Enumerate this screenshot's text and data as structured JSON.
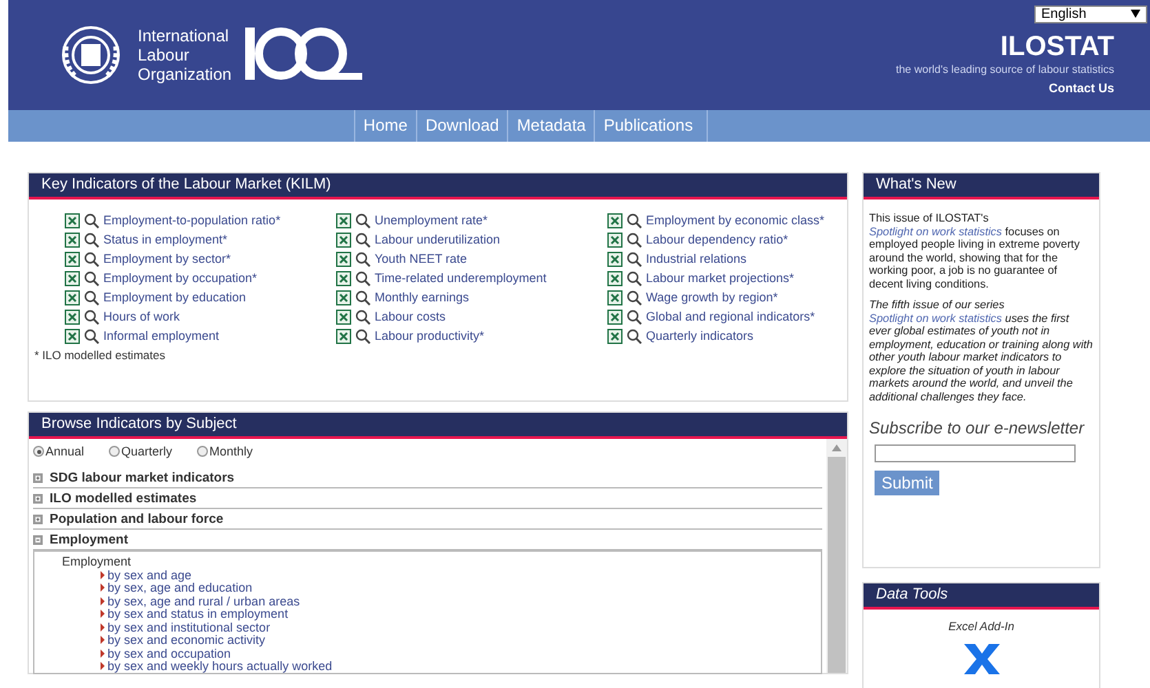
{
  "header": {
    "org_name": [
      "International",
      "Labour",
      "Organization"
    ],
    "language": "English",
    "site_title": "ILOSTAT",
    "tagline": "the world's leading source of labour statistics",
    "contact": "Contact Us"
  },
  "nav": [
    "Home",
    "Download",
    "Metadata",
    "Publications"
  ],
  "kilm": {
    "title": "Key Indicators of the Labour Market (KILM)",
    "columns": [
      [
        "Employment-to-population ratio*",
        "Status in employment*",
        "Employment by sector*",
        "Employment by occupation*",
        "Employment by education",
        "Hours of work",
        "Informal employment"
      ],
      [
        "Unemployment rate*",
        "Labour underutilization",
        "Youth NEET rate",
        "Time-related underemployment",
        "Monthly earnings",
        "Labour costs",
        "Labour productivity*"
      ],
      [
        "Employment by economic class*",
        "Labour dependency ratio*",
        "Industrial relations",
        "Labour market projections*",
        "Wage growth by region*",
        "Global and regional indicators*",
        "Quarterly indicators"
      ]
    ],
    "footnote": "* ILO modelled estimates"
  },
  "browse": {
    "title": "Browse Indicators by Subject",
    "frequency": [
      {
        "label": "Annual",
        "selected": true
      },
      {
        "label": "Quarterly",
        "selected": false
      },
      {
        "label": "Monthly",
        "selected": false
      }
    ],
    "sections": [
      {
        "label": "SDG labour market indicators",
        "expanded": false
      },
      {
        "label": "ILO modelled estimates",
        "expanded": false
      },
      {
        "label": "Population and labour force",
        "expanded": false
      },
      {
        "label": "Employment",
        "expanded": true
      }
    ],
    "subsection": {
      "title": "Employment",
      "items": [
        "by sex and age",
        "by sex, age and education",
        "by sex, age and rural / urban areas",
        "by sex and status in employment",
        "by sex and institutional sector",
        "by sex and economic activity",
        "by sex and occupation",
        "by sex and weekly hours actually worked"
      ]
    }
  },
  "whats_new": {
    "title": "What's New",
    "paragraphs": [
      {
        "italic": false,
        "parts": [
          {
            "kind": "text",
            "text": "This issue of ILOSTAT's"
          },
          {
            "kind": "link",
            "text": "Spotlight on work statistics"
          },
          {
            "kind": "text",
            "text": "focuses on employed people living in extreme poverty around the world, showing that for the working poor, a job is no guarantee of decent living conditions."
          }
        ]
      },
      {
        "italic": true,
        "parts": [
          {
            "kind": "text",
            "text": "The fifth issue of our series"
          },
          {
            "kind": "link",
            "text": "Spotlight on work statistics"
          },
          {
            "kind": "text",
            "text": "uses the first ever global estimates of youth not in employment, education or training along with other youth labour market indicators to explore the situation of youth in labour markets around the world, and unveil the additional challenges they face."
          }
        ]
      }
    ],
    "subscribe_title": "Subscribe to our e-newsletter",
    "submit": "Submit"
  },
  "data_tools": {
    "title": "Data Tools",
    "excel_label": "Excel Add-In"
  }
}
